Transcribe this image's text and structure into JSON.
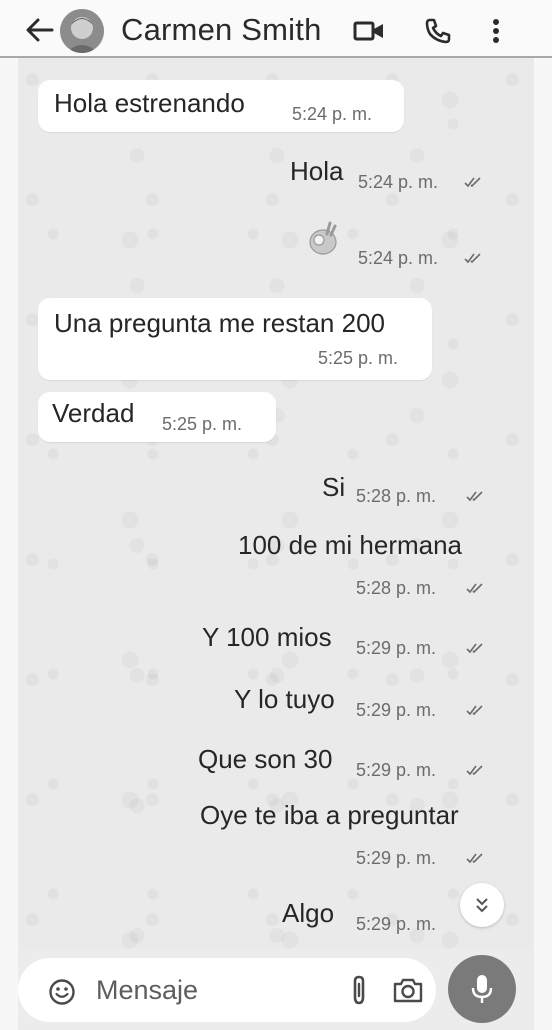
{
  "header": {
    "contact_name": "Carmen Smith"
  },
  "messages": [
    {
      "direction": "in",
      "text": "Hola estrenando",
      "time": "5:24 p. m."
    },
    {
      "direction": "out",
      "text": "Hola",
      "time": "5:24 p. m."
    },
    {
      "direction": "out",
      "text": "",
      "emoji": "ok-hand",
      "time": "5:24 p. m."
    },
    {
      "direction": "in",
      "text": "Una pregunta me restan 200",
      "time": "5:25 p. m."
    },
    {
      "direction": "in",
      "text": "Verdad",
      "time": "5:25 p. m."
    },
    {
      "direction": "out",
      "text": "Si",
      "time": "5:28 p. m."
    },
    {
      "direction": "out",
      "text": "100 de mi hermana",
      "time": "5:28 p. m."
    },
    {
      "direction": "out",
      "text": "Y 100 mios",
      "time": "5:29 p. m."
    },
    {
      "direction": "out",
      "text": "Y lo tuyo",
      "time": "5:29 p. m."
    },
    {
      "direction": "out",
      "text": "Que son 30",
      "time": "5:29 p. m."
    },
    {
      "direction": "out",
      "text": "Oye te iba a preguntar",
      "time": "5:29 p. m."
    },
    {
      "direction": "out",
      "text": "Algo",
      "time": "5:29 p. m."
    }
  ],
  "composer": {
    "placeholder": "Mensaje"
  },
  "icons": {
    "back": "arrow-left-icon",
    "video": "video-call-icon",
    "call": "phone-icon",
    "menu": "more-vert-icon",
    "emoji": "smiley-icon",
    "attach": "paperclip-icon",
    "camera": "camera-icon",
    "mic": "mic-icon",
    "scroll": "double-chevron-down-icon"
  },
  "colors": {
    "chat_background": "#eaeaea",
    "bubble_incoming": "#ffffff",
    "mic_button": "#7a7a7a"
  }
}
